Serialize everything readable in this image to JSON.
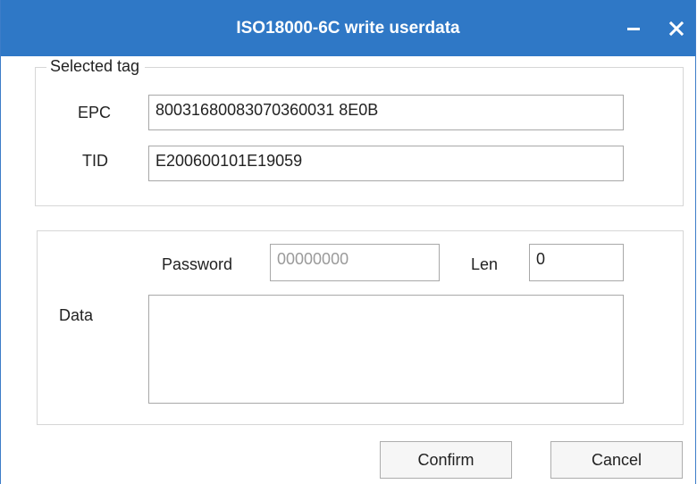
{
  "window": {
    "title": "ISO18000-6C write userdata"
  },
  "selected_tag": {
    "legend": "Selected tag",
    "epc_label": "EPC",
    "epc_value": "80031680083070360031 8E0B",
    "tid_label": "TID",
    "tid_value": "E200600101E19059"
  },
  "write_group": {
    "password_label": "Password",
    "password_value": "00000000",
    "len_label": "Len",
    "len_value": "0",
    "data_label": "Data",
    "data_value": ""
  },
  "buttons": {
    "confirm_label": "Confirm",
    "cancel_label": "Cancel"
  },
  "colors": {
    "titlebar": "#2f78c6",
    "border": "#d6d6d6"
  }
}
